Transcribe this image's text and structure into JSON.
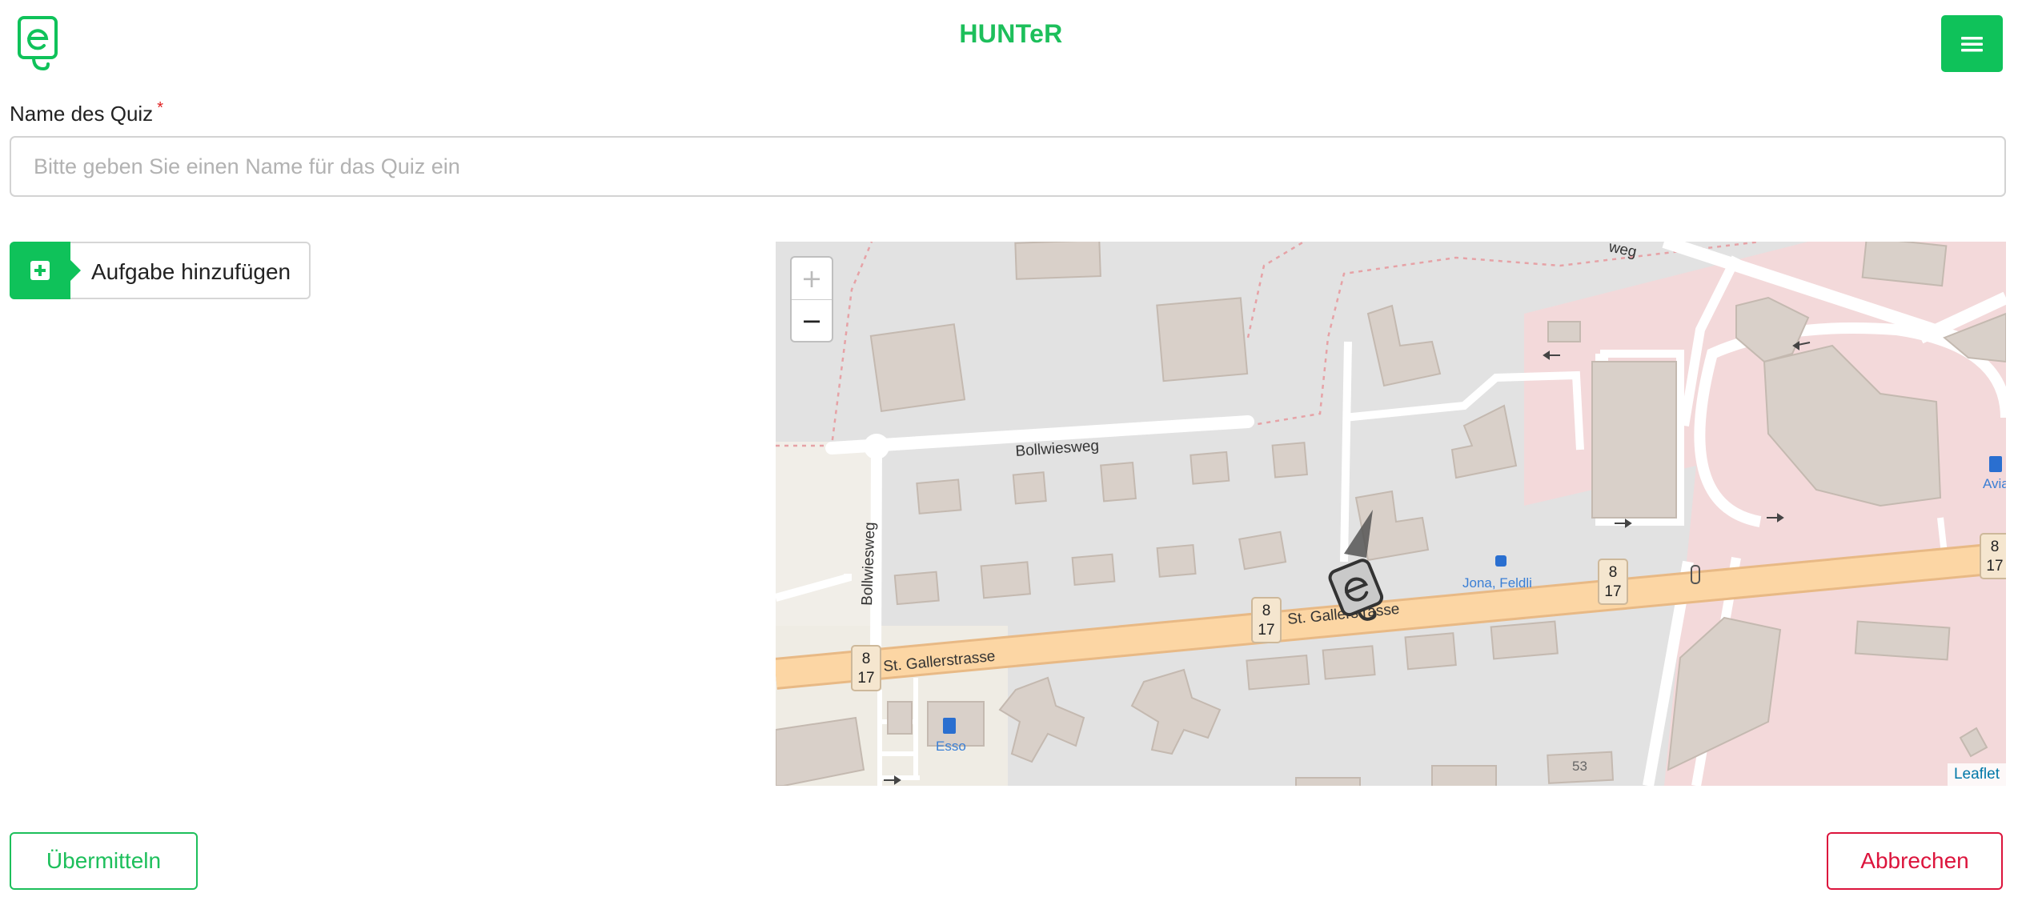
{
  "header": {
    "title": "HUNTeR",
    "logo_icon": "hunter-e-logo-icon",
    "menu_icon": "hamburger-menu-icon",
    "accent_color": "#0fc25a"
  },
  "form": {
    "quiz_name_label": "Name des Quiz",
    "required_marker": "*",
    "quiz_name_placeholder": "Bitte geben Sie einen Name für das Quiz ein",
    "quiz_name_value": "",
    "add_task_label": "Aufgabe hinzufügen",
    "add_task_icon": "plus-square-icon"
  },
  "map": {
    "zoom_in": "+",
    "zoom_out": "−",
    "attribution": "Leaflet",
    "streets": {
      "bollwiesweg": "Bollwiesweg",
      "st_gallerstrasse": "St. Gallerstrasse",
      "partial_weg": "weg"
    },
    "route_shields": [
      "8",
      "17"
    ],
    "pois": {
      "bus_stop": "Jona, Feldli",
      "fuel_esso": "Esso",
      "fuel_avia": "Avia"
    },
    "house_number": "53",
    "marker_icon": "hunter-map-marker-icon"
  },
  "actions": {
    "submit_label": "Übermitteln",
    "cancel_label": "Abbrechen",
    "submit_color": "#1dbf5b",
    "cancel_color": "#dc143c"
  }
}
